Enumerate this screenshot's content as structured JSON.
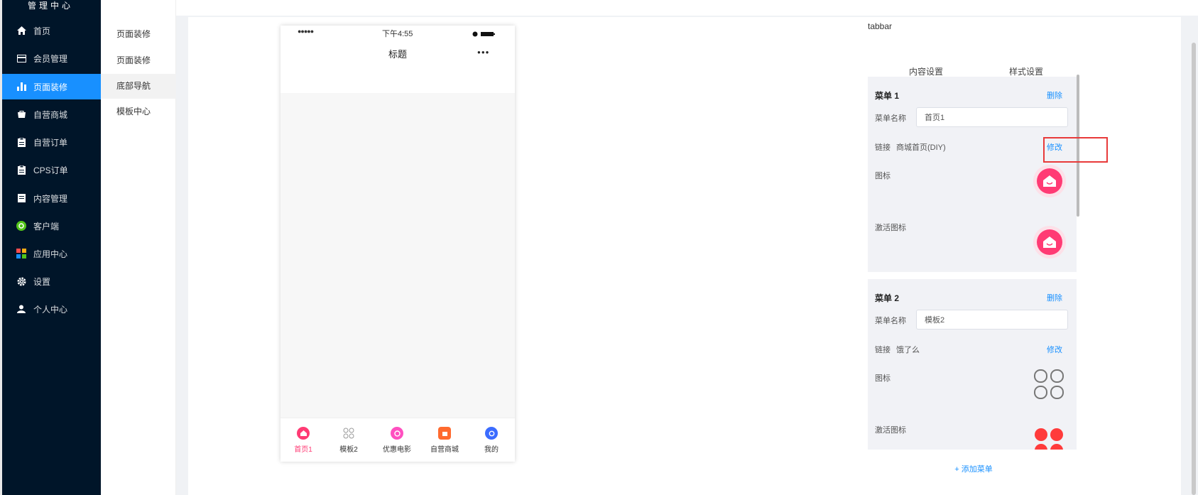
{
  "sidebar": {
    "brand": "管理中心",
    "items": [
      {
        "label": "首页",
        "icon": "home-icon"
      },
      {
        "label": "会员管理",
        "icon": "card-icon"
      },
      {
        "label": "页面装修",
        "icon": "bar-chart-icon",
        "active": true
      },
      {
        "label": "自营商城",
        "icon": "shop-icon"
      },
      {
        "label": "自营订单",
        "icon": "clipboard-icon"
      },
      {
        "label": "CPS订单",
        "icon": "clipboard-icon"
      },
      {
        "label": "内容管理",
        "icon": "document-icon"
      },
      {
        "label": "客户端",
        "icon": "mini-program-icon"
      },
      {
        "label": "应用中心",
        "icon": "apps-icon"
      },
      {
        "label": "设置",
        "icon": "gear-icon"
      },
      {
        "label": "个人中心",
        "icon": "user-icon"
      }
    ]
  },
  "subnav": {
    "items": [
      {
        "label": "页面装修"
      },
      {
        "label": "页面装修"
      },
      {
        "label": "底部导航",
        "active": true
      },
      {
        "label": "模板中心"
      }
    ]
  },
  "phone": {
    "time": "下午4:55",
    "signal": "●●●●●",
    "title": "标题",
    "more": "●●●",
    "tabs": [
      {
        "label": "首页1",
        "color": "#ff3b74",
        "active": true
      },
      {
        "label": "模板2",
        "color": "#999999"
      },
      {
        "label": "优惠电影",
        "color": "#ff4fc0"
      },
      {
        "label": "自营商城",
        "color": "#ff6a2f"
      },
      {
        "label": "我的",
        "color": "#3b6cff"
      }
    ]
  },
  "panel": {
    "head": "tabbar",
    "tab_content": "内容设置",
    "tab_style": "样式设置",
    "menu_name_label": "菜单名称",
    "link_label": "链接",
    "icon_label": "图标",
    "active_icon_label": "激活图标",
    "delete_label": "删除",
    "edit_label": "修改",
    "menus": [
      {
        "title": "菜单 1",
        "name": "首页1",
        "link": "商城首页(DIY)"
      },
      {
        "title": "菜单 2",
        "name": "模板2",
        "link": "饿了么"
      }
    ],
    "add_menu": "+ 添加菜单"
  },
  "colors": {
    "sidebar_bg": "#001529",
    "active_bg": "#1890ff",
    "link": "#1890ff",
    "highlight_box": "#e83a3a",
    "tab_active": "#ff3b74"
  }
}
